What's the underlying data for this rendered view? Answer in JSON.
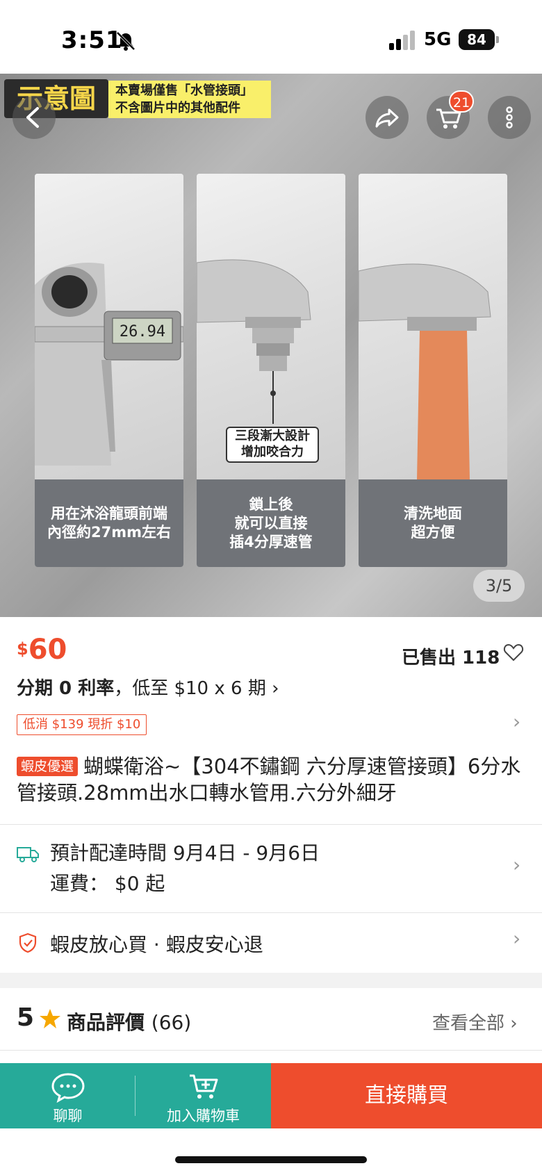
{
  "status_bar": {
    "time": "3:51",
    "network": "5G",
    "battery": "84"
  },
  "hero": {
    "demo_badge": "示意圖",
    "notice_line1": "本賣場僅售「水管接頭」",
    "notice_line2": "不含圖片中的其他配件",
    "cart_count": "21",
    "page_indicator": "3/5",
    "panels": [
      {
        "caption": "用在沐浴龍頭前端\n內徑約27mm左右"
      },
      {
        "caption": "鎖上後\n就可以直接\n插4分厚速管"
      },
      {
        "caption": "清洗地面\n超方便"
      }
    ],
    "callout": "三段漸大設計\n增加咬合力",
    "caliper_reading": "26.94"
  },
  "price": {
    "currency": "$",
    "amount": "60",
    "sold": "已售出 118",
    "installment_bold": "分期 0 利率",
    "installment_rest": "，低至 $10 x 6 期 ›",
    "coupon": "低消 $139 現折 $10"
  },
  "product": {
    "mall_tag": "蝦皮優選",
    "title": "蝴蝶衛浴~【304不鏽鋼 六分厚速管接頭】6分水管接頭.28mm出水口轉水管用.六分外細牙"
  },
  "shipping": {
    "delivery": "預計配達時間 9月4日 - 9月6日",
    "fee": "運費： $0 起"
  },
  "guarantee": {
    "text": "蝦皮放心買 · 蝦皮安心退"
  },
  "rating": {
    "score": "5",
    "label": "商品評價",
    "count": "(66)",
    "see_all": "查看全部"
  },
  "bottom_bar": {
    "chat_label": "聊聊",
    "add_cart_label": "加入購物車",
    "buy_label": "直接購買"
  },
  "colors": {
    "brand": "#ee4d2d",
    "teal": "#26aa99"
  }
}
